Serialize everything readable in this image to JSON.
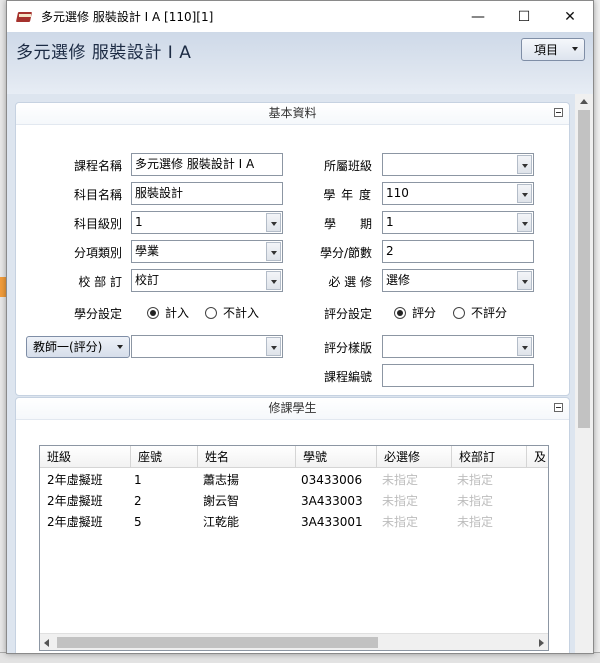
{
  "window": {
    "title": "多元選修 服裝設計 I A [110][1]",
    "controls": [
      "—",
      "☐",
      "✕"
    ]
  },
  "header": {
    "page_title": "多元選修  服裝設計 I A",
    "menu_button": "項目"
  },
  "basic_info": {
    "section_title": "基本資料",
    "course_name": {
      "label": "課程名稱",
      "value": "多元選修 服裝設計 I A"
    },
    "subject_name": {
      "label": "科目名稱",
      "value": "服裝設計"
    },
    "subject_level": {
      "label": "科目級別",
      "value": "1"
    },
    "category": {
      "label": "分項類別",
      "value": "學業"
    },
    "school_required": {
      "label": "校 部 訂",
      "value": "校訂"
    },
    "credit_setting": {
      "label": "學分設定",
      "options": [
        "計入",
        "不計入"
      ],
      "selected": "計入"
    },
    "teacher_button": "教師一(評分)",
    "teacher_value": "",
    "class": {
      "label": "所屬班級",
      "value": ""
    },
    "school_year": {
      "label": "學 年 度",
      "value": "110"
    },
    "semester": {
      "label": "學　　期",
      "value": "1"
    },
    "credits": {
      "label": "學分/節數",
      "value": "2"
    },
    "required_elective": {
      "label": "必 選 修",
      "value": "選修"
    },
    "grading_setting": {
      "label": "評分設定",
      "options": [
        "評分",
        "不評分"
      ],
      "selected": "評分"
    },
    "grading_template": {
      "label": "評分樣版",
      "value": ""
    },
    "course_code": {
      "label": "課程編號",
      "value": ""
    }
  },
  "students": {
    "section_title": "修課學生",
    "columns": [
      "班級",
      "座號",
      "姓名",
      "學號",
      "必選修",
      "校部訂",
      "及"
    ],
    "rows": [
      [
        "2年虛擬班",
        "1",
        "蕭志揚",
        "03433006",
        "未指定",
        "未指定"
      ],
      [
        "2年虛擬班",
        "2",
        "謝云智",
        "3A433003",
        "未指定",
        "未指定"
      ],
      [
        "2年虛擬班",
        "5",
        "江乾能",
        "3A433001",
        "未指定",
        "未指定"
      ]
    ]
  }
}
